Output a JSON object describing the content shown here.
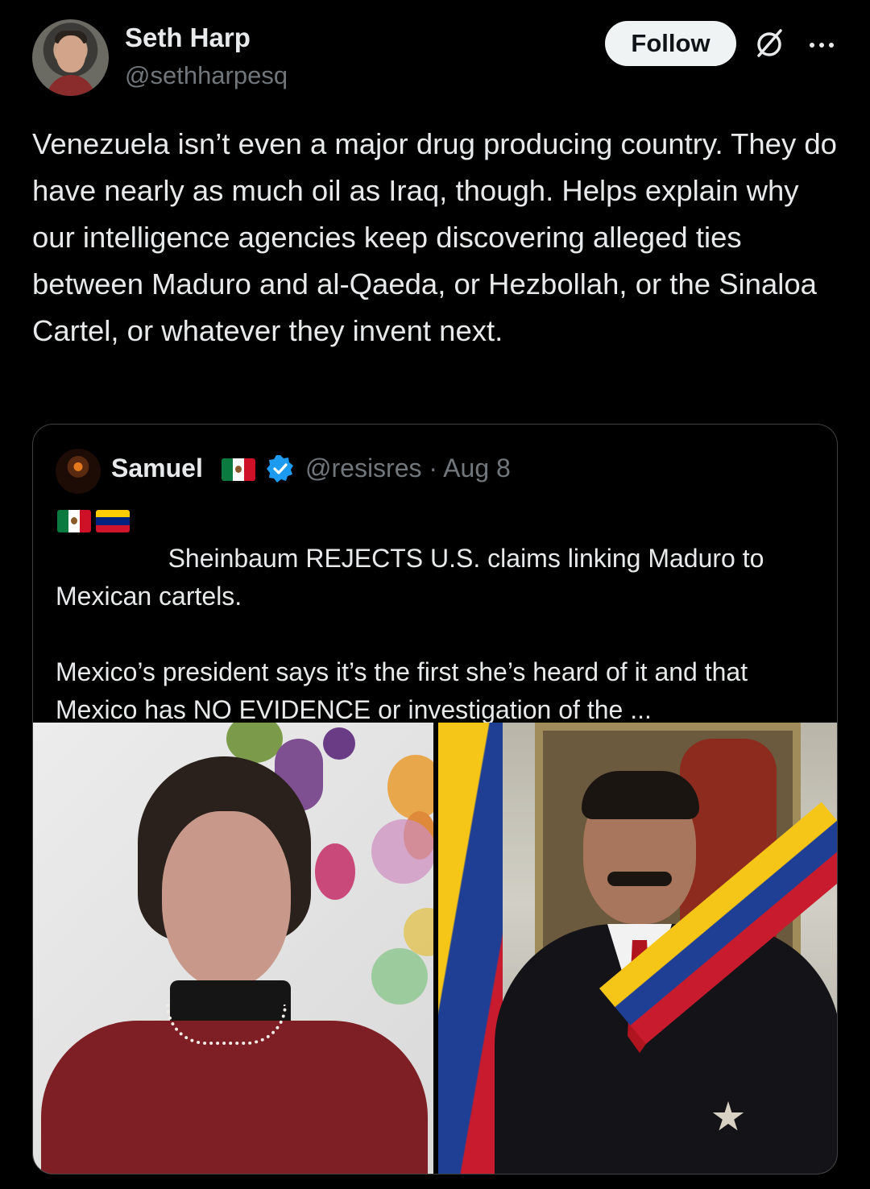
{
  "author": {
    "name": "Seth Harp",
    "handle": "@sethharpesq",
    "follow_label": "Follow"
  },
  "header_icons": {
    "grok": "grok-icon",
    "more": "more-icon"
  },
  "tweet": {
    "text": "Venezuela isn’t even a major drug producing country. They do have nearly as much oil as Iraq, though. Helps explain why our intelligence agencies keep discovering alleged ties between Maduro and al-Qaeda, or Hezbollah, or the Sinaloa Cartel, or whatever they invent next."
  },
  "quoted": {
    "name": "Samuel",
    "handle_date": "@resisres · Aug 8",
    "headline": "Sheinbaum REJECTS U.S. claims linking Maduro to Mexican cartels.",
    "body": "Mexico’s president says it’s the first she’s heard of it and that Mexico has NO EVIDENCE or investigation of the ...",
    "media": [
      "photo-sheinbaum",
      "photo-maduro"
    ]
  },
  "colors": {
    "background": "#000000",
    "text": "#e7e9ea",
    "muted": "#71767b",
    "verified": "#1d9bf0",
    "border": "#3e4144"
  }
}
